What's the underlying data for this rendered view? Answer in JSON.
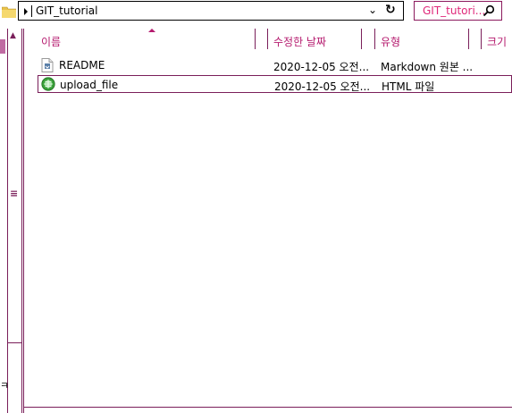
{
  "address_bar": {
    "path": "GIT_tutorial",
    "dropdown_glyph": "⌄",
    "refresh_glyph": "↻"
  },
  "search": {
    "text": "GIT_tutori..."
  },
  "nav": {
    "up_glyph": "▲",
    "grip_glyph": "≡",
    "fragment": "ㅋ"
  },
  "columns": {
    "name": "이름",
    "date": "수정한 날짜",
    "type": "유형",
    "size": "크기"
  },
  "files": [
    {
      "name": "README",
      "date": "2020-12-05 오전...",
      "type": "Markdown 원본 ...",
      "icon": "markdown-file-icon",
      "selected": false
    },
    {
      "name": "upload_file",
      "date": "2020-12-05 오전...",
      "type": "HTML 파일",
      "icon": "html-file-icon",
      "selected": true
    }
  ],
  "colors": {
    "accent": "#b51a6e",
    "border": "#7a1f5a",
    "search_text": "#e0287a"
  }
}
